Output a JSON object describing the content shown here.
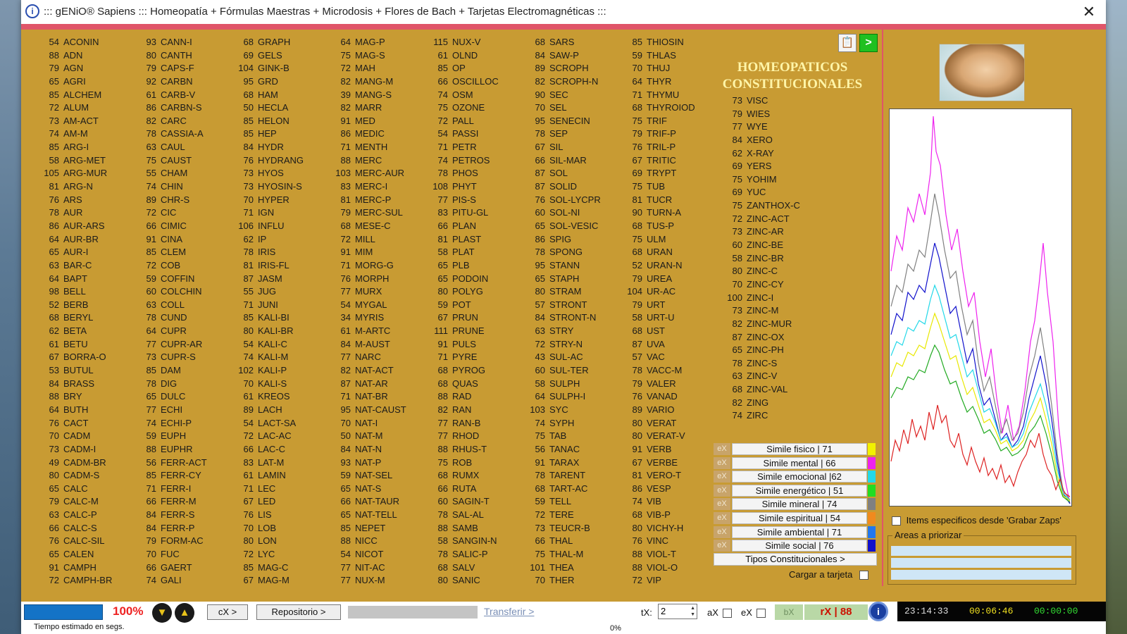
{
  "window": {
    "title": "::: gENiO® Sapiens ::: Homeopatía + Fórmulas Maestras + Microdosis + Flores de Bach + Tarjetas Electromagnéticas :::",
    "close": "✕"
  },
  "remedy_columns": [
    [
      [
        "54",
        "ACONIN"
      ],
      [
        "88",
        "ADN"
      ],
      [
        "79",
        "AGN"
      ],
      [
        "65",
        "AGRI"
      ],
      [
        "85",
        "ALCHEM"
      ],
      [
        "72",
        "ALUM"
      ],
      [
        "73",
        "AM-ACT"
      ],
      [
        "74",
        "AM-M"
      ],
      [
        "85",
        "ARG-I"
      ],
      [
        "58",
        "ARG-MET"
      ],
      [
        "105",
        "ARG-MUR"
      ],
      [
        "81",
        "ARG-N"
      ],
      [
        "76",
        "ARS"
      ],
      [
        "78",
        "AUR"
      ],
      [
        "86",
        "AUR-ARS"
      ],
      [
        "64",
        "AUR-BR"
      ],
      [
        "65",
        "AUR-I"
      ],
      [
        "63",
        "BAR-C"
      ],
      [
        "64",
        "BAPT"
      ],
      [
        "98",
        "BELL"
      ],
      [
        "52",
        "BERB"
      ],
      [
        "68",
        "BERYL"
      ],
      [
        "62",
        "BETA"
      ],
      [
        "61",
        "BETU"
      ],
      [
        "67",
        "BORRA-O"
      ],
      [
        "53",
        "BUTUL"
      ],
      [
        "84",
        "BRASS"
      ],
      [
        "88",
        "BRY"
      ],
      [
        "64",
        "BUTH"
      ],
      [
        "76",
        "CACT"
      ],
      [
        "70",
        "CADM"
      ],
      [
        "73",
        "CADM-I"
      ],
      [
        "49",
        "CADM-BR"
      ],
      [
        "80",
        "CADM-S"
      ],
      [
        "65",
        "CALC"
      ],
      [
        "79",
        "CALC-M"
      ],
      [
        "63",
        "CALC-P"
      ],
      [
        "66",
        "CALC-S"
      ],
      [
        "76",
        "CALC-SIL"
      ],
      [
        "65",
        "CALEN"
      ],
      [
        "91",
        "CAMPH"
      ],
      [
        "72",
        "CAMPH-BR"
      ]
    ],
    [
      [
        "93",
        "CANN-I"
      ],
      [
        "80",
        "CANTH"
      ],
      [
        "79",
        "CAPS-F"
      ],
      [
        "92",
        "CARBN"
      ],
      [
        "61",
        "CARB-V"
      ],
      [
        "86",
        "CARBN-S"
      ],
      [
        "82",
        "CARC"
      ],
      [
        "78",
        "CASSIA-A"
      ],
      [
        "63",
        "CAUL"
      ],
      [
        "75",
        "CAUST"
      ],
      [
        "55",
        "CHAM"
      ],
      [
        "74",
        "CHIN"
      ],
      [
        "89",
        "CHR-S"
      ],
      [
        "72",
        "CIC"
      ],
      [
        "66",
        "CIMIC"
      ],
      [
        "91",
        "CINA"
      ],
      [
        "85",
        "CLEM"
      ],
      [
        "72",
        "COB"
      ],
      [
        "59",
        "COFFIN"
      ],
      [
        "60",
        "COLCHIN"
      ],
      [
        "63",
        "COLL"
      ],
      [
        "78",
        "CUND"
      ],
      [
        "64",
        "CUPR"
      ],
      [
        "77",
        "CUPR-AR"
      ],
      [
        "73",
        "CUPR-S"
      ],
      [
        "85",
        "DAM"
      ],
      [
        "78",
        "DIG"
      ],
      [
        "65",
        "DULC"
      ],
      [
        "77",
        "ECHI"
      ],
      [
        "74",
        "ECHI-P"
      ],
      [
        "59",
        "EUPH"
      ],
      [
        "88",
        "EUPHR"
      ],
      [
        "56",
        "FERR-ACT"
      ],
      [
        "85",
        "FERR-CY"
      ],
      [
        "71",
        "FERR-I"
      ],
      [
        "66",
        "FERR-M"
      ],
      [
        "84",
        "FERR-S"
      ],
      [
        "84",
        "FERR-P"
      ],
      [
        "79",
        "FORM-AC"
      ],
      [
        "70",
        "FUC"
      ],
      [
        "66",
        "GAERT"
      ],
      [
        "74",
        "GALI"
      ]
    ],
    [
      [
        "68",
        "GRAPH"
      ],
      [
        "69",
        "GELS"
      ],
      [
        "104",
        "GINK-B"
      ],
      [
        "95",
        "GRD"
      ],
      [
        "68",
        "HAM"
      ],
      [
        "50",
        "HECLA"
      ],
      [
        "85",
        "HELON"
      ],
      [
        "85",
        "HEP"
      ],
      [
        "84",
        "HYDR"
      ],
      [
        "76",
        "HYDRANG"
      ],
      [
        "73",
        "HYOS"
      ],
      [
        "73",
        "HYOSIN-S"
      ],
      [
        "70",
        "HYPER"
      ],
      [
        "71",
        "IGN"
      ],
      [
        "106",
        "INFLU"
      ],
      [
        "62",
        "IP"
      ],
      [
        "78",
        "IRIS"
      ],
      [
        "81",
        "IRIS-FL"
      ],
      [
        "87",
        "JASM"
      ],
      [
        "55",
        "JUG"
      ],
      [
        "71",
        "JUNI"
      ],
      [
        "85",
        "KALI-BI"
      ],
      [
        "80",
        "KALI-BR"
      ],
      [
        "54",
        "KALI-C"
      ],
      [
        "74",
        "KALI-M"
      ],
      [
        "102",
        "KALI-P"
      ],
      [
        "70",
        "KALI-S"
      ],
      [
        "61",
        "KREOS"
      ],
      [
        "89",
        "LACH"
      ],
      [
        "54",
        "LACT-SA"
      ],
      [
        "72",
        "LAC-AC"
      ],
      [
        "66",
        "LAC-C"
      ],
      [
        "83",
        "LAT-M"
      ],
      [
        "61",
        "LAMIN"
      ],
      [
        "71",
        "LEC"
      ],
      [
        "67",
        "LED"
      ],
      [
        "76",
        "LIS"
      ],
      [
        "70",
        "LOB"
      ],
      [
        "80",
        "LON"
      ],
      [
        "72",
        "LYC"
      ],
      [
        "85",
        "MAG-C"
      ],
      [
        "67",
        "MAG-M"
      ]
    ],
    [
      [
        "64",
        "MAG-P"
      ],
      [
        "75",
        "MAG-S"
      ],
      [
        "72",
        "MAH"
      ],
      [
        "82",
        "MANG-M"
      ],
      [
        "39",
        "MANG-S"
      ],
      [
        "82",
        "MARR"
      ],
      [
        "91",
        "MED"
      ],
      [
        "86",
        "MEDIC"
      ],
      [
        "71",
        "MENTH"
      ],
      [
        "88",
        "MERC"
      ],
      [
        "103",
        "MERC-AUR"
      ],
      [
        "83",
        "MERC-I"
      ],
      [
        "81",
        "MERC-P"
      ],
      [
        "79",
        "MERC-SUL"
      ],
      [
        "68",
        "MESE-C"
      ],
      [
        "72",
        "MILL"
      ],
      [
        "91",
        "MIM"
      ],
      [
        "71",
        "MORG-G"
      ],
      [
        "76",
        "MORPH"
      ],
      [
        "77",
        "MURX"
      ],
      [
        "54",
        "MYGAL"
      ],
      [
        "34",
        "MYRIS"
      ],
      [
        "61",
        "M-ARTC"
      ],
      [
        "84",
        "M-AUST"
      ],
      [
        "77",
        "NARC"
      ],
      [
        "82",
        "NAT-ACT"
      ],
      [
        "87",
        "NAT-AR"
      ],
      [
        "71",
        "NAT-BR"
      ],
      [
        "95",
        "NAT-CAUST"
      ],
      [
        "70",
        "NAT-I"
      ],
      [
        "50",
        "NAT-M"
      ],
      [
        "84",
        "NAT-N"
      ],
      [
        "93",
        "NAT-P"
      ],
      [
        "59",
        "NAT-SEL"
      ],
      [
        "65",
        "NAT-S"
      ],
      [
        "66",
        "NAT-TAUR"
      ],
      [
        "65",
        "NAT-TELL"
      ],
      [
        "85",
        "NEPET"
      ],
      [
        "88",
        "NICC"
      ],
      [
        "54",
        "NICOT"
      ],
      [
        "77",
        "NIT-AC"
      ],
      [
        "77",
        "NUX-M"
      ]
    ],
    [
      [
        "115",
        "NUX-V"
      ],
      [
        "61",
        "OLND"
      ],
      [
        "85",
        "OP"
      ],
      [
        "66",
        "OSCILLOC"
      ],
      [
        "74",
        "OSM"
      ],
      [
        "75",
        "OZONE"
      ],
      [
        "72",
        "PALL"
      ],
      [
        "54",
        "PASSI"
      ],
      [
        "71",
        "PETR"
      ],
      [
        "74",
        "PETROS"
      ],
      [
        "78",
        "PHOS"
      ],
      [
        "108",
        "PHYT"
      ],
      [
        "77",
        "PIS-S"
      ],
      [
        "83",
        "PITU-GL"
      ],
      [
        "66",
        "PLAN"
      ],
      [
        "81",
        "PLAST"
      ],
      [
        "58",
        "PLAT"
      ],
      [
        "65",
        "PLB"
      ],
      [
        "65",
        "PODOIN"
      ],
      [
        "80",
        "POLYG"
      ],
      [
        "59",
        "POT"
      ],
      [
        "67",
        "PRUN"
      ],
      [
        "111",
        "PRUNE"
      ],
      [
        "91",
        "PULS"
      ],
      [
        "71",
        "PYRE"
      ],
      [
        "68",
        "PYROG"
      ],
      [
        "68",
        "QUAS"
      ],
      [
        "88",
        "RAD"
      ],
      [
        "82",
        "RAN"
      ],
      [
        "77",
        "RAN-B"
      ],
      [
        "77",
        "RHOD"
      ],
      [
        "88",
        "RHUS-T"
      ],
      [
        "75",
        "ROB"
      ],
      [
        "68",
        "RUMX"
      ],
      [
        "66",
        "RUTA"
      ],
      [
        "60",
        "SAGIN-T"
      ],
      [
        "78",
        "SAL-AL"
      ],
      [
        "88",
        "SAMB"
      ],
      [
        "58",
        "SANGIN-N"
      ],
      [
        "78",
        "SALIC-P"
      ],
      [
        "68",
        "SALV"
      ],
      [
        "80",
        "SANIC"
      ]
    ],
    [
      [
        "68",
        "SARS"
      ],
      [
        "84",
        "SAW-P"
      ],
      [
        "89",
        "SCROPH"
      ],
      [
        "82",
        "SCROPH-N"
      ],
      [
        "90",
        "SEC"
      ],
      [
        "70",
        "SEL"
      ],
      [
        "95",
        "SENECIN"
      ],
      [
        "78",
        "SEP"
      ],
      [
        "67",
        "SIL"
      ],
      [
        "66",
        "SIL-MAR"
      ],
      [
        "87",
        "SOL"
      ],
      [
        "87",
        "SOLID"
      ],
      [
        "76",
        "SOL-LYCPR"
      ],
      [
        "60",
        "SOL-NI"
      ],
      [
        "65",
        "SOL-VESIC"
      ],
      [
        "86",
        "SPIG"
      ],
      [
        "78",
        "SPONG"
      ],
      [
        "95",
        "STANN"
      ],
      [
        "65",
        "STAPH"
      ],
      [
        "80",
        "STRAM"
      ],
      [
        "57",
        "STRONT"
      ],
      [
        "84",
        "STRONT-N"
      ],
      [
        "63",
        "STRY"
      ],
      [
        "72",
        "STRY-N"
      ],
      [
        "43",
        "SUL-AC"
      ],
      [
        "60",
        "SUL-TER"
      ],
      [
        "58",
        "SULPH"
      ],
      [
        "64",
        "SULPH-I"
      ],
      [
        "103",
        "SYC"
      ],
      [
        "74",
        "SYPH"
      ],
      [
        "75",
        "TAB"
      ],
      [
        "56",
        "TANAC"
      ],
      [
        "91",
        "TARAX"
      ],
      [
        "78",
        "TARENT"
      ],
      [
        "68",
        "TART-AC"
      ],
      [
        "59",
        "TELL"
      ],
      [
        "72",
        "TERE"
      ],
      [
        "73",
        "TEUCR-B"
      ],
      [
        "66",
        "THAL"
      ],
      [
        "75",
        "THAL-M"
      ],
      [
        "101",
        "THEA"
      ],
      [
        "70",
        "THER"
      ]
    ],
    [
      [
        "85",
        "THIOSIN"
      ],
      [
        "59",
        "THLAS"
      ],
      [
        "70",
        "THUJ"
      ],
      [
        "64",
        "THYR"
      ],
      [
        "71",
        "THYMU"
      ],
      [
        "68",
        "THYROIOD"
      ],
      [
        "75",
        "TRIF"
      ],
      [
        "79",
        "TRIF-P"
      ],
      [
        "76",
        "TRIL-P"
      ],
      [
        "67",
        "TRITIC"
      ],
      [
        "69",
        "TRYPT"
      ],
      [
        "75",
        "TUB"
      ],
      [
        "81",
        "TUCR"
      ],
      [
        "90",
        "TURN-A"
      ],
      [
        "68",
        "TUS-P"
      ],
      [
        "75",
        "ULM"
      ],
      [
        "68",
        "URAN"
      ],
      [
        "52",
        "URAN-N"
      ],
      [
        "79",
        "UREA"
      ],
      [
        "104",
        "UR-AC"
      ],
      [
        "79",
        "URT"
      ],
      [
        "58",
        "URT-U"
      ],
      [
        "68",
        "UST"
      ],
      [
        "87",
        "UVA"
      ],
      [
        "57",
        "VAC"
      ],
      [
        "78",
        "VACC-M"
      ],
      [
        "79",
        "VALER"
      ],
      [
        "76",
        "VANAD"
      ],
      [
        "89",
        "VARIO"
      ],
      [
        "80",
        "VERAT"
      ],
      [
        "80",
        "VERAT-V"
      ],
      [
        "91",
        "VERB"
      ],
      [
        "67",
        "VERBE"
      ],
      [
        "81",
        "VERO-T"
      ],
      [
        "86",
        "VESP"
      ],
      [
        "74",
        "VIB"
      ],
      [
        "68",
        "VIB-P"
      ],
      [
        "80",
        "VICHY-H"
      ],
      [
        "76",
        "VINC"
      ],
      [
        "88",
        "VIOL-T"
      ],
      [
        "88",
        "VIOL-O"
      ],
      [
        "72",
        "VIP"
      ]
    ]
  ],
  "homeo_title_line1": "HOMEOPATICOS",
  "homeo_title_line2": "CONSTITUCIONALES",
  "extra_items": [
    [
      "73",
      "VISC"
    ],
    [
      "79",
      "WIES"
    ],
    [
      "77",
      "WYE"
    ],
    [
      "84",
      "XERO"
    ],
    [
      "62",
      "X-RAY"
    ],
    [
      "69",
      "YERS"
    ],
    [
      "75",
      "YOHIM"
    ],
    [
      "69",
      "YUC"
    ],
    [
      "75",
      "ZANTHOX-C"
    ],
    [
      "72",
      "ZINC-ACT"
    ],
    [
      "73",
      "ZINC-AR"
    ],
    [
      "60",
      "ZINC-BE"
    ],
    [
      "58",
      "ZINC-BR"
    ],
    [
      "80",
      "ZINC-C"
    ],
    [
      "70",
      "ZINC-CY"
    ],
    [
      "100",
      "ZINC-I"
    ],
    [
      "73",
      "ZINC-M"
    ],
    [
      "82",
      "ZINC-MUR"
    ],
    [
      "87",
      "ZINC-OX"
    ],
    [
      "65",
      "ZINC-PH"
    ],
    [
      "78",
      "ZINC-S"
    ],
    [
      "63",
      "ZINC-V"
    ],
    [
      "68",
      "ZINC-VAL"
    ],
    [
      "82",
      "ZING"
    ],
    [
      "74",
      "ZIRC"
    ]
  ],
  "toolbar_icons": {
    "doc": "document-icon",
    "play": ">"
  },
  "similes": [
    {
      "ex": "eX",
      "label": "Simile fisico | 71",
      "color": "#f2f200"
    },
    {
      "ex": "eX",
      "label": "Simile mental | 66",
      "color": "#ee22ee"
    },
    {
      "ex": "eX",
      "label": "Simile emocional |62",
      "color": "#22d8e8"
    },
    {
      "ex": "eX",
      "label": "Simile energético | 51",
      "color": "#22dd22"
    },
    {
      "ex": "eX",
      "label": "Simile mineral | 74",
      "color": "#808080"
    },
    {
      "ex": "eX",
      "label": "Simile espiritual | 54",
      "color": "#f08a1e"
    },
    {
      "ex": "eX",
      "label": "Simile ambiental | 71",
      "color": "#2277ee"
    },
    {
      "ex": "eX",
      "label": "Simile social | 76",
      "color": "#1111cc"
    }
  ],
  "tipos_button": "Tipos Constitucionales >",
  "cargar_label": "Cargar a tarjeta",
  "items_especificos": "Items especificos desde 'Grabar Zaps'",
  "areas_label": "Areas a priorizar",
  "status": {
    "percent": "100%",
    "cx_button": "cX >",
    "repositorio_button": "Repositorio >",
    "transferir_link": "Transferir >",
    "tx_label": "tX:",
    "tx_value": "2",
    "ax_label": "aX",
    "ex_label": "eX",
    "bx_button": "bX",
    "rx_value": "rX | 88",
    "clock_time": "23:14:33",
    "clock_elapsed": "00:06:46",
    "clock_remaining": "00:00:00",
    "estimated_text": "Tiempo estimado en segs.",
    "zero_percent": "0%"
  }
}
